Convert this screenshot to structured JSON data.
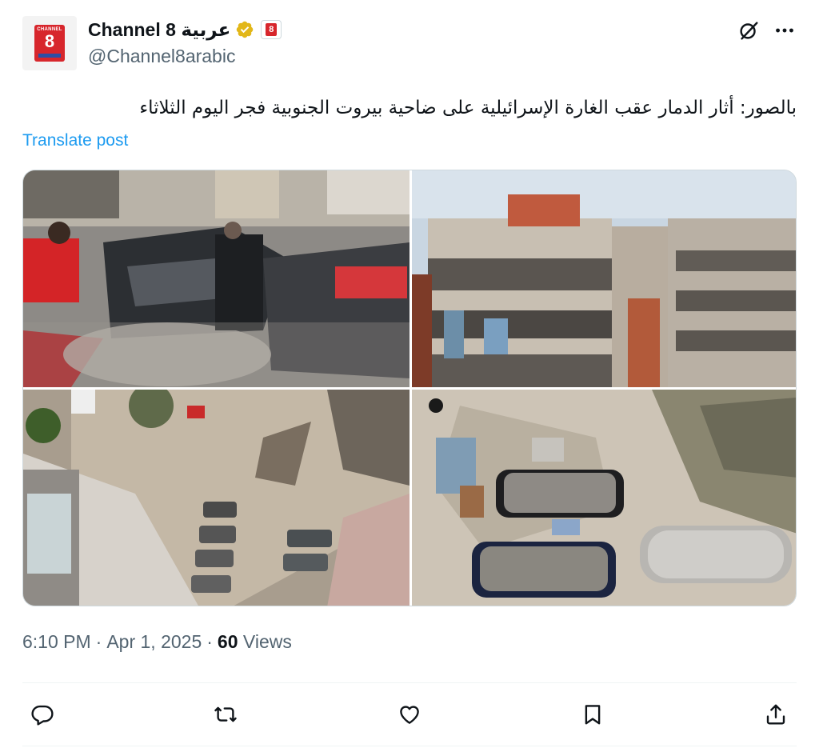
{
  "post": {
    "author": {
      "name": "Channel 8 عربية",
      "handle": "@Channel8arabic",
      "avatar_brand_top": "CHANNEL",
      "avatar_brand_num": "8",
      "affiliate_badge": "8",
      "verified_color": "#e2b719"
    },
    "text": "بالصور: أثار الدمار عقب الغارة الإسرائيلية على ضاحية بيروت الجنوبية فجر اليوم الثلاثاء",
    "translate_label": "Translate post",
    "meta": {
      "time": "6:10 PM",
      "separator": "·",
      "date": "Apr 1, 2025",
      "views_count": "60",
      "views_label": "Views"
    },
    "actions": [
      "reply-icon",
      "repost-icon",
      "like-icon",
      "bookmark-icon",
      "share-icon"
    ],
    "top_icons": [
      "grok-icon",
      "more-icon"
    ],
    "colors": {
      "link": "#1d9bf0",
      "secondary_text": "#536471",
      "brand_red": "#d7262c"
    }
  }
}
